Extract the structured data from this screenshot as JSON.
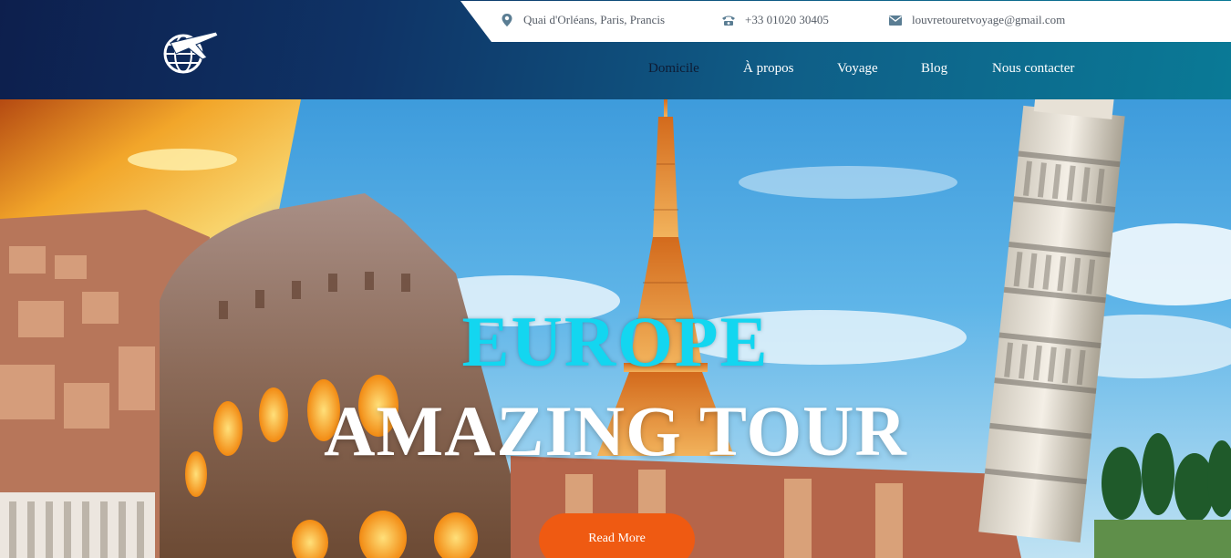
{
  "contact": {
    "address": "Quai d'Orléans, Paris, Prancis",
    "phone": "+33 01020 30405",
    "email": "louvretouretvoyage@gmail.com"
  },
  "nav": {
    "items": [
      {
        "label": "Domicile",
        "active": true
      },
      {
        "label": "À propos",
        "active": false
      },
      {
        "label": "Voyage",
        "active": false
      },
      {
        "label": "Blog",
        "active": false
      },
      {
        "label": "Nous contacter",
        "active": false
      }
    ]
  },
  "hero": {
    "title_line1": "EUROPE",
    "title_line2": "AMAZING TOUR",
    "cta_label": "Read More"
  },
  "icons": {
    "address": "map-pin-icon",
    "phone": "telephone-icon",
    "email": "envelope-icon",
    "logo": "globe-airplane-logo"
  },
  "colors": {
    "accent_cyan": "#13d6f0",
    "cta_orange": "#ef5a12",
    "header_navy": "#0d1f4d",
    "header_teal": "#0a7a96",
    "active_nav": "#0e1b33"
  }
}
